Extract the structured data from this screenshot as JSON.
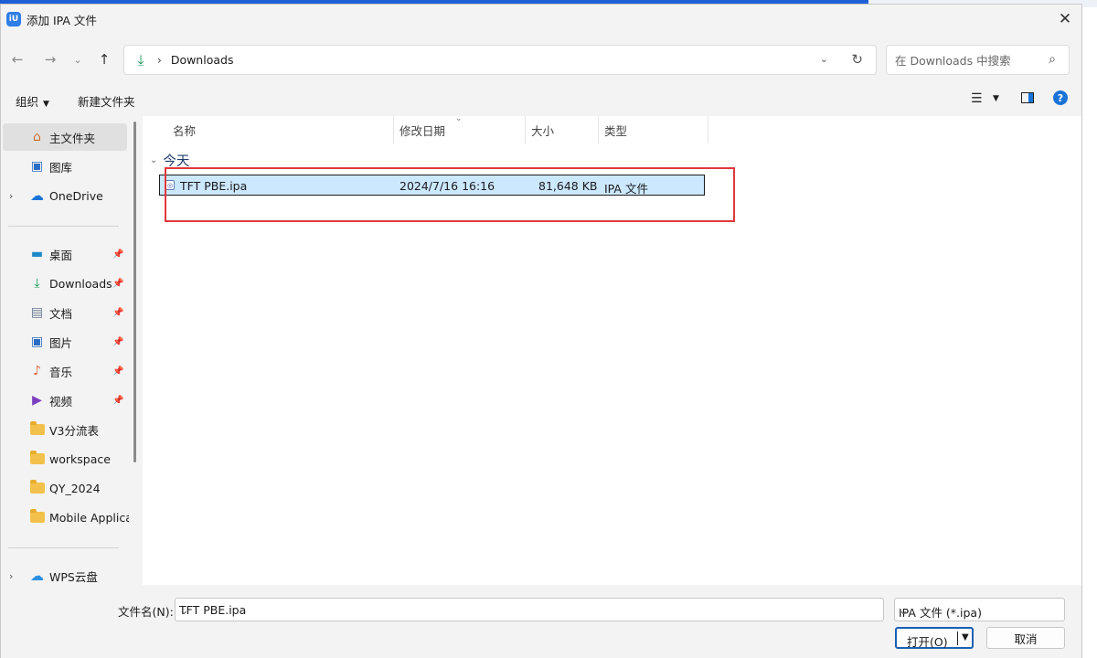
{
  "window": {
    "title": "添加 IPA 文件",
    "app_icon_text": "iU"
  },
  "address_bar": {
    "location": "Downloads",
    "search_placeholder": "在 Downloads 中搜索"
  },
  "toolbar": {
    "organize": "组织",
    "new_folder": "新建文件夹"
  },
  "sidebar": {
    "items": [
      {
        "label": "主文件夹",
        "icon": "home-icon",
        "selected": true,
        "expandable": false,
        "pinned": false
      },
      {
        "label": "图库",
        "icon": "gallery-icon",
        "selected": false,
        "expandable": false,
        "pinned": false
      },
      {
        "label": "OneDrive",
        "icon": "cloud-icon",
        "selected": false,
        "expandable": true,
        "pinned": false
      },
      {
        "label": "桌面",
        "icon": "desktop-icon",
        "selected": false,
        "expandable": false,
        "pinned": true
      },
      {
        "label": "Downloads",
        "icon": "download-icon",
        "selected": false,
        "expandable": false,
        "pinned": true
      },
      {
        "label": "文档",
        "icon": "document-icon",
        "selected": false,
        "expandable": false,
        "pinned": true
      },
      {
        "label": "图片",
        "icon": "picture-icon",
        "selected": false,
        "expandable": false,
        "pinned": true
      },
      {
        "label": "音乐",
        "icon": "music-icon",
        "selected": false,
        "expandable": false,
        "pinned": true
      },
      {
        "label": "视频",
        "icon": "video-icon",
        "selected": false,
        "expandable": false,
        "pinned": true
      },
      {
        "label": "V3分流表",
        "icon": "folder-icon",
        "selected": false,
        "expandable": false,
        "pinned": false
      },
      {
        "label": "workspace",
        "icon": "folder-icon",
        "selected": false,
        "expandable": false,
        "pinned": false
      },
      {
        "label": "QY_2024",
        "icon": "folder-icon",
        "selected": false,
        "expandable": false,
        "pinned": false
      },
      {
        "label": "Mobile Applica",
        "icon": "folder-icon",
        "selected": false,
        "expandable": false,
        "pinned": false
      },
      {
        "label": "WPS云盘",
        "icon": "wps-cloud-icon",
        "selected": false,
        "expandable": true,
        "pinned": false
      }
    ]
  },
  "file_list": {
    "columns": [
      "名称",
      "修改日期",
      "大小",
      "类型"
    ],
    "groups": [
      {
        "label": "今天",
        "rows": [
          {
            "name": "TFT PBE.ipa",
            "modified": "2024/7/16 16:16",
            "size": "81,648 KB",
            "type": "IPA 文件",
            "selected": true
          }
        ]
      }
    ]
  },
  "bottom_bar": {
    "filename_label": "文件名(N):",
    "filename_value": "TFT PBE.ipa",
    "file_type": "IPA 文件 (*.ipa)",
    "open_label": "打开(O)",
    "cancel_label": "取消"
  },
  "colors": {
    "selection": "#cce8ff",
    "highlight_box": "#e0393e",
    "accent": "#1a5fb4"
  }
}
